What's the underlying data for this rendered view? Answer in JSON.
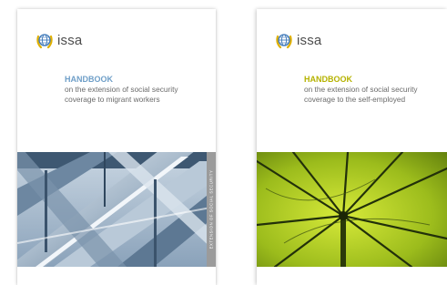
{
  "colors": {
    "heading_blue": "#6f9fc8",
    "heading_yellow": "#b5b200",
    "logo_text": "#4d4d4d",
    "subtitle": "#6b6b6b"
  },
  "covers": [
    {
      "logo_text": "issa",
      "logo_icon": "globe-laurel-icon",
      "heading": "HANDBOOK",
      "subtitle_line1": "on the extension of social security",
      "subtitle_line2": "coverage to migrant workers",
      "spine_text": "EXTENSION OF SOCIAL SECURITY",
      "photo": "escalator-photo"
    },
    {
      "logo_text": "issa",
      "logo_icon": "globe-laurel-icon",
      "heading": "HANDBOOK",
      "subtitle_line1": "on the extension of social security",
      "subtitle_line2": "coverage to the self-employed",
      "photo": "umbrella-photo"
    }
  ]
}
